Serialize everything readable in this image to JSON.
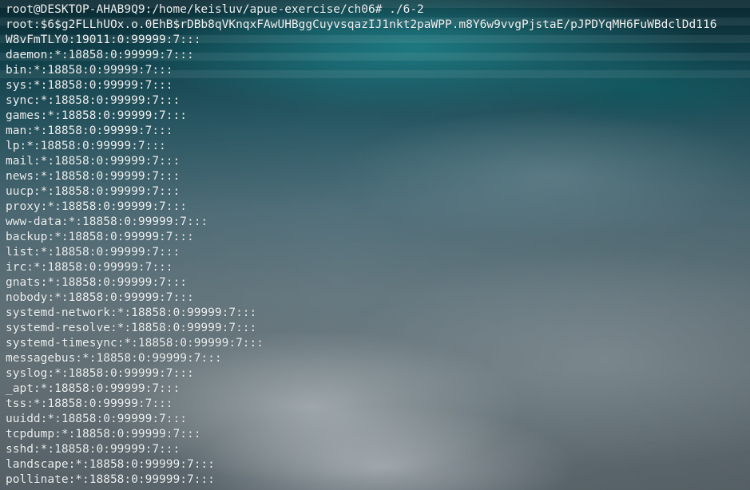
{
  "terminal": {
    "prompt_line": "root@DESKTOP-AHAB9Q9:/home/keisluv/apue-exercise/ch06# ./6-2",
    "output": [
      "root:$6$g2FLLhUOx.o.0EhB$rDBb8qVKnqxFAwUHBggCuyvsqazIJ1nkt2paWPP.m8Y6w9vvgPjstaE/pJPDYqMH6FuWBdclDd116",
      "W8vFmTLY0:19011:0:99999:7:::",
      "daemon:*:18858:0:99999:7:::",
      "bin:*:18858:0:99999:7:::",
      "sys:*:18858:0:99999:7:::",
      "sync:*:18858:0:99999:7:::",
      "games:*:18858:0:99999:7:::",
      "man:*:18858:0:99999:7:::",
      "lp:*:18858:0:99999:7:::",
      "mail:*:18858:0:99999:7:::",
      "news:*:18858:0:99999:7:::",
      "uucp:*:18858:0:99999:7:::",
      "proxy:*:18858:0:99999:7:::",
      "www-data:*:18858:0:99999:7:::",
      "backup:*:18858:0:99999:7:::",
      "list:*:18858:0:99999:7:::",
      "irc:*:18858:0:99999:7:::",
      "gnats:*:18858:0:99999:7:::",
      "nobody:*:18858:0:99999:7:::",
      "systemd-network:*:18858:0:99999:7:::",
      "systemd-resolve:*:18858:0:99999:7:::",
      "systemd-timesync:*:18858:0:99999:7:::",
      "messagebus:*:18858:0:99999:7:::",
      "syslog:*:18858:0:99999:7:::",
      "_apt:*:18858:0:99999:7:::",
      "tss:*:18858:0:99999:7:::",
      "uuidd:*:18858:0:99999:7:::",
      "tcpdump:*:18858:0:99999:7:::",
      "sshd:*:18858:0:99999:7:::",
      "landscape:*:18858:0:99999:7:::",
      "pollinate:*:18858:0:99999:7:::"
    ]
  }
}
